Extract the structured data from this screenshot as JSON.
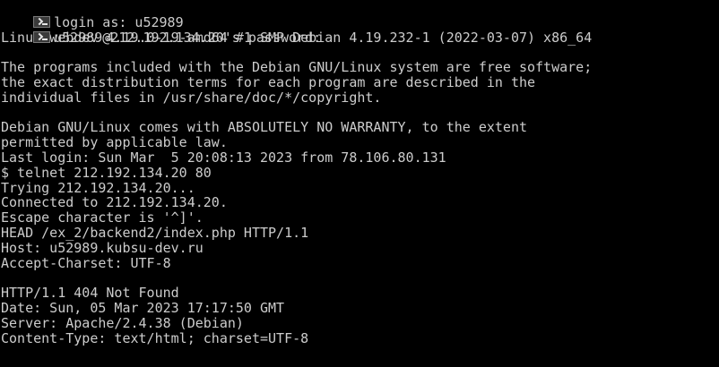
{
  "terminal": {
    "background": "#000000",
    "foreground": "#cccccc",
    "login_line": "login as: u52989",
    "password_line": "u52989@212.192.134.20's password:",
    "lines": [
      "Linux webdev 4.19.0-19-amd64 #1 SMP Debian 4.19.232-1 (2022-03-07) x86_64",
      "",
      "The programs included with the Debian GNU/Linux system are free software;",
      "the exact distribution terms for each program are described in the",
      "individual files in /usr/share/doc/*/copyright.",
      "",
      "Debian GNU/Linux comes with ABSOLUTELY NO WARRANTY, to the extent",
      "permitted by applicable law.",
      "Last login: Sun Mar  5 20:08:13 2023 from 78.106.80.131",
      "$ telnet 212.192.134.20 80",
      "Trying 212.192.134.20...",
      "Connected to 212.192.134.20.",
      "Escape character is '^]'.",
      "HEAD /ex_2/backend2/index.php HTTP/1.1",
      "Host: u52989.kubsu-dev.ru",
      "Accept-Charset: UTF-8",
      "",
      "HTTP/1.1 404 Not Found",
      "Date: Sun, 05 Mar 2023 17:17:50 GMT",
      "Server: Apache/2.4.38 (Debian)",
      "Content-Type: text/html; charset=UTF-8"
    ]
  }
}
